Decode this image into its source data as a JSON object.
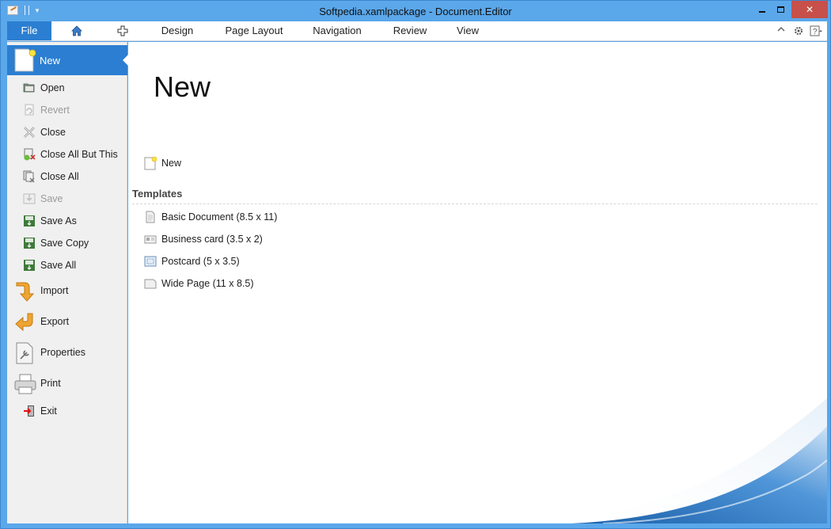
{
  "window": {
    "title": "Softpedia.xamlpackage - Document.Editor",
    "minimize": "minimize",
    "maximize": "maximize",
    "close": "✕"
  },
  "ribbon": {
    "file_label": "File",
    "tabs": [
      "Design",
      "Page Layout",
      "Navigation",
      "Review",
      "View"
    ]
  },
  "sidebar": {
    "selected": "New",
    "items": [
      {
        "label": "Open",
        "icon": "folder-open-icon",
        "enabled": true
      },
      {
        "label": "Revert",
        "icon": "revert-icon",
        "enabled": false
      },
      {
        "label": "Close",
        "icon": "close-doc-icon",
        "enabled": true
      },
      {
        "label": "Close All But This",
        "icon": "close-all-but-this-icon",
        "enabled": true
      },
      {
        "label": "Close All",
        "icon": "close-all-icon",
        "enabled": true
      },
      {
        "label": "Save",
        "icon": "save-icon",
        "enabled": false
      },
      {
        "label": "Save As",
        "icon": "save-as-icon",
        "enabled": true
      },
      {
        "label": "Save Copy",
        "icon": "save-copy-icon",
        "enabled": true
      },
      {
        "label": "Save All",
        "icon": "save-all-icon",
        "enabled": true
      }
    ],
    "big_items": [
      {
        "label": "Import",
        "icon": "import-arrow-icon"
      },
      {
        "label": "Export",
        "icon": "export-arrow-icon"
      },
      {
        "label": "Properties",
        "icon": "properties-icon"
      },
      {
        "label": "Print",
        "icon": "printer-icon"
      }
    ],
    "exit_label": "Exit"
  },
  "main": {
    "heading": "New",
    "new_item": "New",
    "templates_heading": "Templates",
    "templates": [
      {
        "label": "Basic Document (8.5 x 11)",
        "icon": "basic-document-icon"
      },
      {
        "label": "Business card (3.5 x 2)",
        "icon": "business-card-icon"
      },
      {
        "label": "Postcard (5 x 3.5)",
        "icon": "postcard-icon"
      },
      {
        "label": "Wide Page (11 x 8.5)",
        "icon": "wide-page-icon"
      }
    ]
  },
  "colors": {
    "accent": "#2b7ed1",
    "frame": "#5aa7ea",
    "close_button": "#c7504a"
  }
}
